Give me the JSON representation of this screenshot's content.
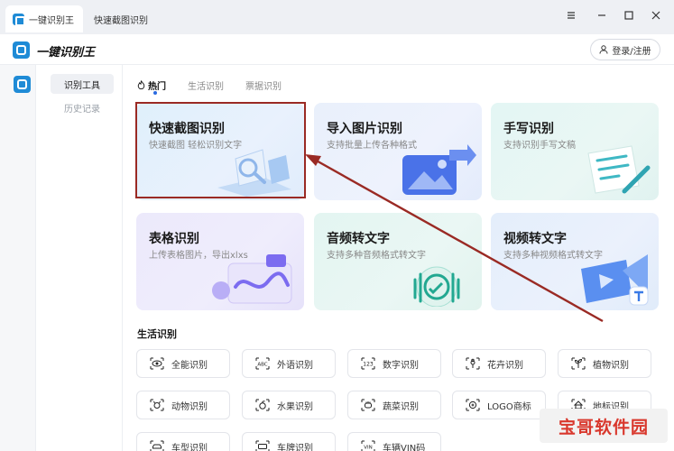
{
  "titlebar": {
    "tabs": [
      {
        "label": "一键识别王",
        "active": true
      },
      {
        "label": "快速截图识别",
        "active": false
      }
    ],
    "controls": [
      "menu-icon",
      "minimize-icon",
      "maximize-icon",
      "close-icon"
    ]
  },
  "header": {
    "app_name": "一键识别王",
    "login_label": "登录/注册"
  },
  "sidebar": {
    "items": [
      {
        "label": "识别工具",
        "active": true
      },
      {
        "label": "历史记录",
        "active": false
      }
    ]
  },
  "main": {
    "tabs": [
      {
        "label": "热门",
        "active": true
      },
      {
        "label": "生活识别",
        "active": false
      },
      {
        "label": "票据识别",
        "active": false
      }
    ],
    "cards": [
      {
        "title": "快速截图识别",
        "subtitle": "快速截图 轻松识别文字"
      },
      {
        "title": "导入图片识别",
        "subtitle": "支持批量上传各种格式"
      },
      {
        "title": "手写识别",
        "subtitle": "支持识别手写文稿"
      },
      {
        "title": "表格识别",
        "subtitle": "上传表格图片，导出xlxs"
      },
      {
        "title": "音频转文字",
        "subtitle": "支持多种音频格式转文字"
      },
      {
        "title": "视频转文字",
        "subtitle": "支持多种视频格式转文字"
      }
    ],
    "section_title": "生活识别",
    "chips": [
      {
        "label": "全能识别",
        "icon": "eye-icon"
      },
      {
        "label": "外语识别",
        "icon": "abc-icon"
      },
      {
        "label": "数字识别",
        "icon": "number-icon"
      },
      {
        "label": "花卉识别",
        "icon": "flower-icon"
      },
      {
        "label": "植物识别",
        "icon": "plant-icon"
      },
      {
        "label": "动物识别",
        "icon": "animal-icon"
      },
      {
        "label": "水果识别",
        "icon": "fruit-icon"
      },
      {
        "label": "蔬菜识别",
        "icon": "vegetable-icon"
      },
      {
        "label": "LOGO商标",
        "icon": "logo-icon"
      },
      {
        "label": "地标识别",
        "icon": "landmark-icon"
      },
      {
        "label": "车型识别",
        "icon": "car-icon"
      },
      {
        "label": "车牌识别",
        "icon": "plate-icon"
      },
      {
        "label": "车辆VIN码",
        "icon": "vin-icon"
      }
    ]
  },
  "watermark": "宝哥软件园",
  "colors": {
    "brand": "#1f8bd6",
    "highlight": "#9a2a24",
    "watermark_text": "#d9382d"
  }
}
